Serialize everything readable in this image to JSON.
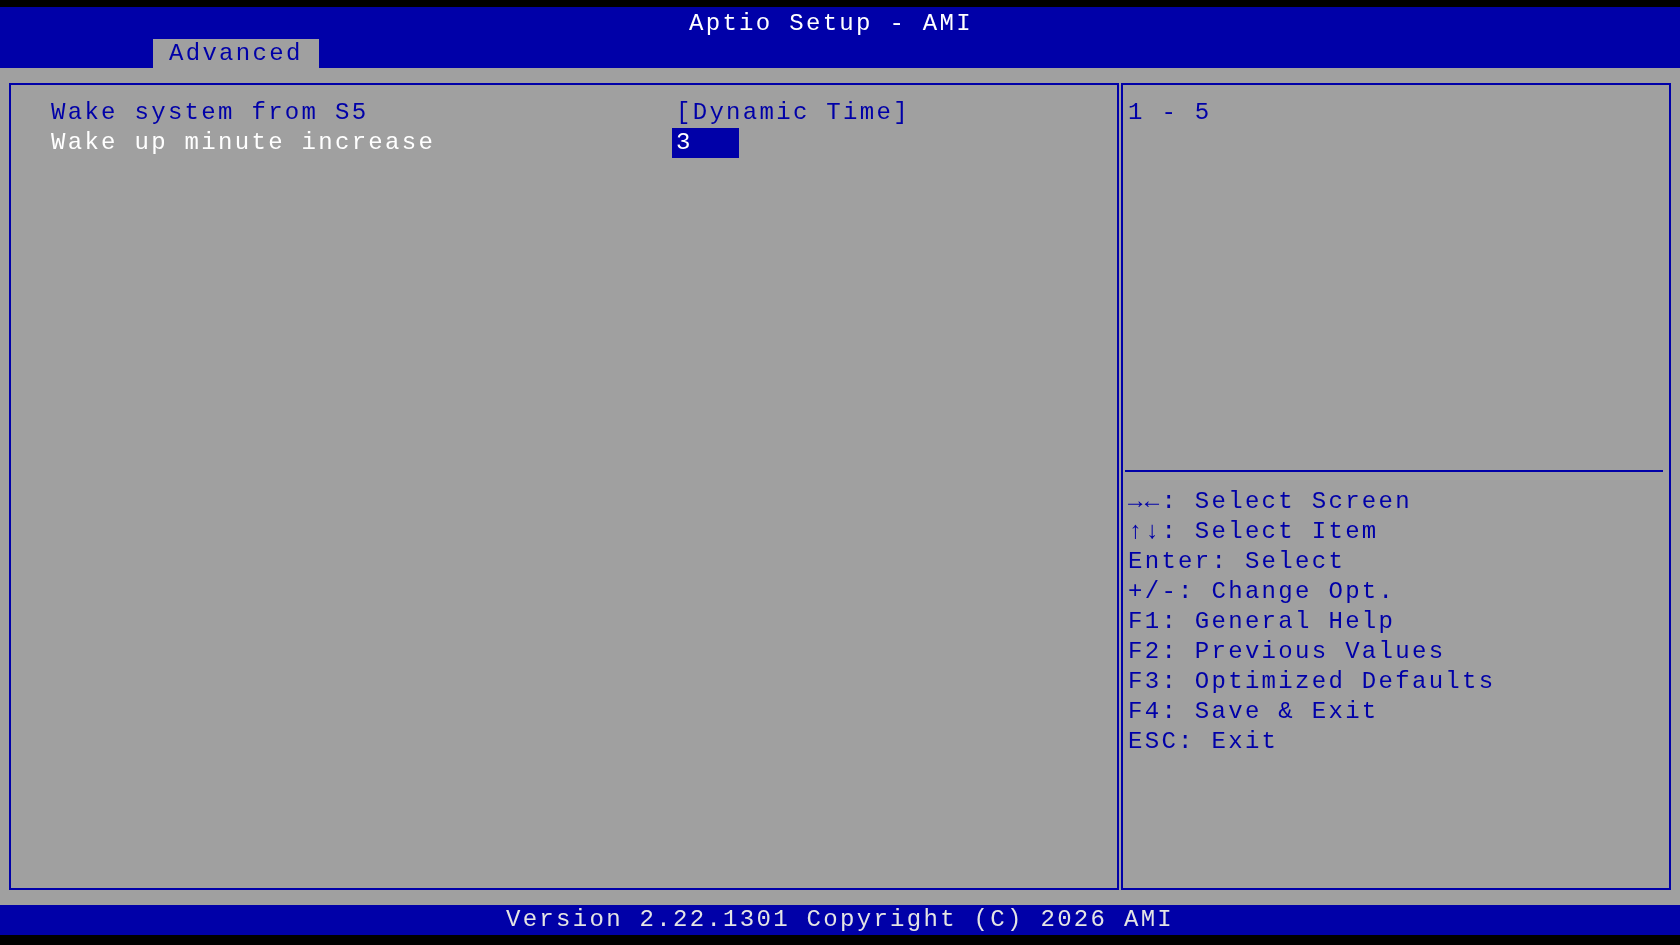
{
  "header": {
    "title": "Aptio Setup - AMI",
    "tabs": [
      {
        "label": "Advanced",
        "selected": true
      }
    ]
  },
  "settings": [
    {
      "label": "Wake system from S5",
      "value": "[Dynamic Time]",
      "kind": "option",
      "selected": false
    },
    {
      "label": "Wake up minute increase",
      "value": "3",
      "kind": "number",
      "selected": true
    }
  ],
  "help": {
    "text": "1 - 5",
    "key_hints": [
      "→←: Select Screen",
      "↑↓: Select Item",
      "Enter: Select",
      "+/-: Change Opt.",
      "F1: General Help",
      "F2: Previous Values",
      "F3: Optimized Defaults",
      "F4: Save & Exit",
      "ESC: Exit"
    ]
  },
  "status_bar": {
    "text": "Version 2.22.1301 Copyright (C) 2026 AMI"
  }
}
